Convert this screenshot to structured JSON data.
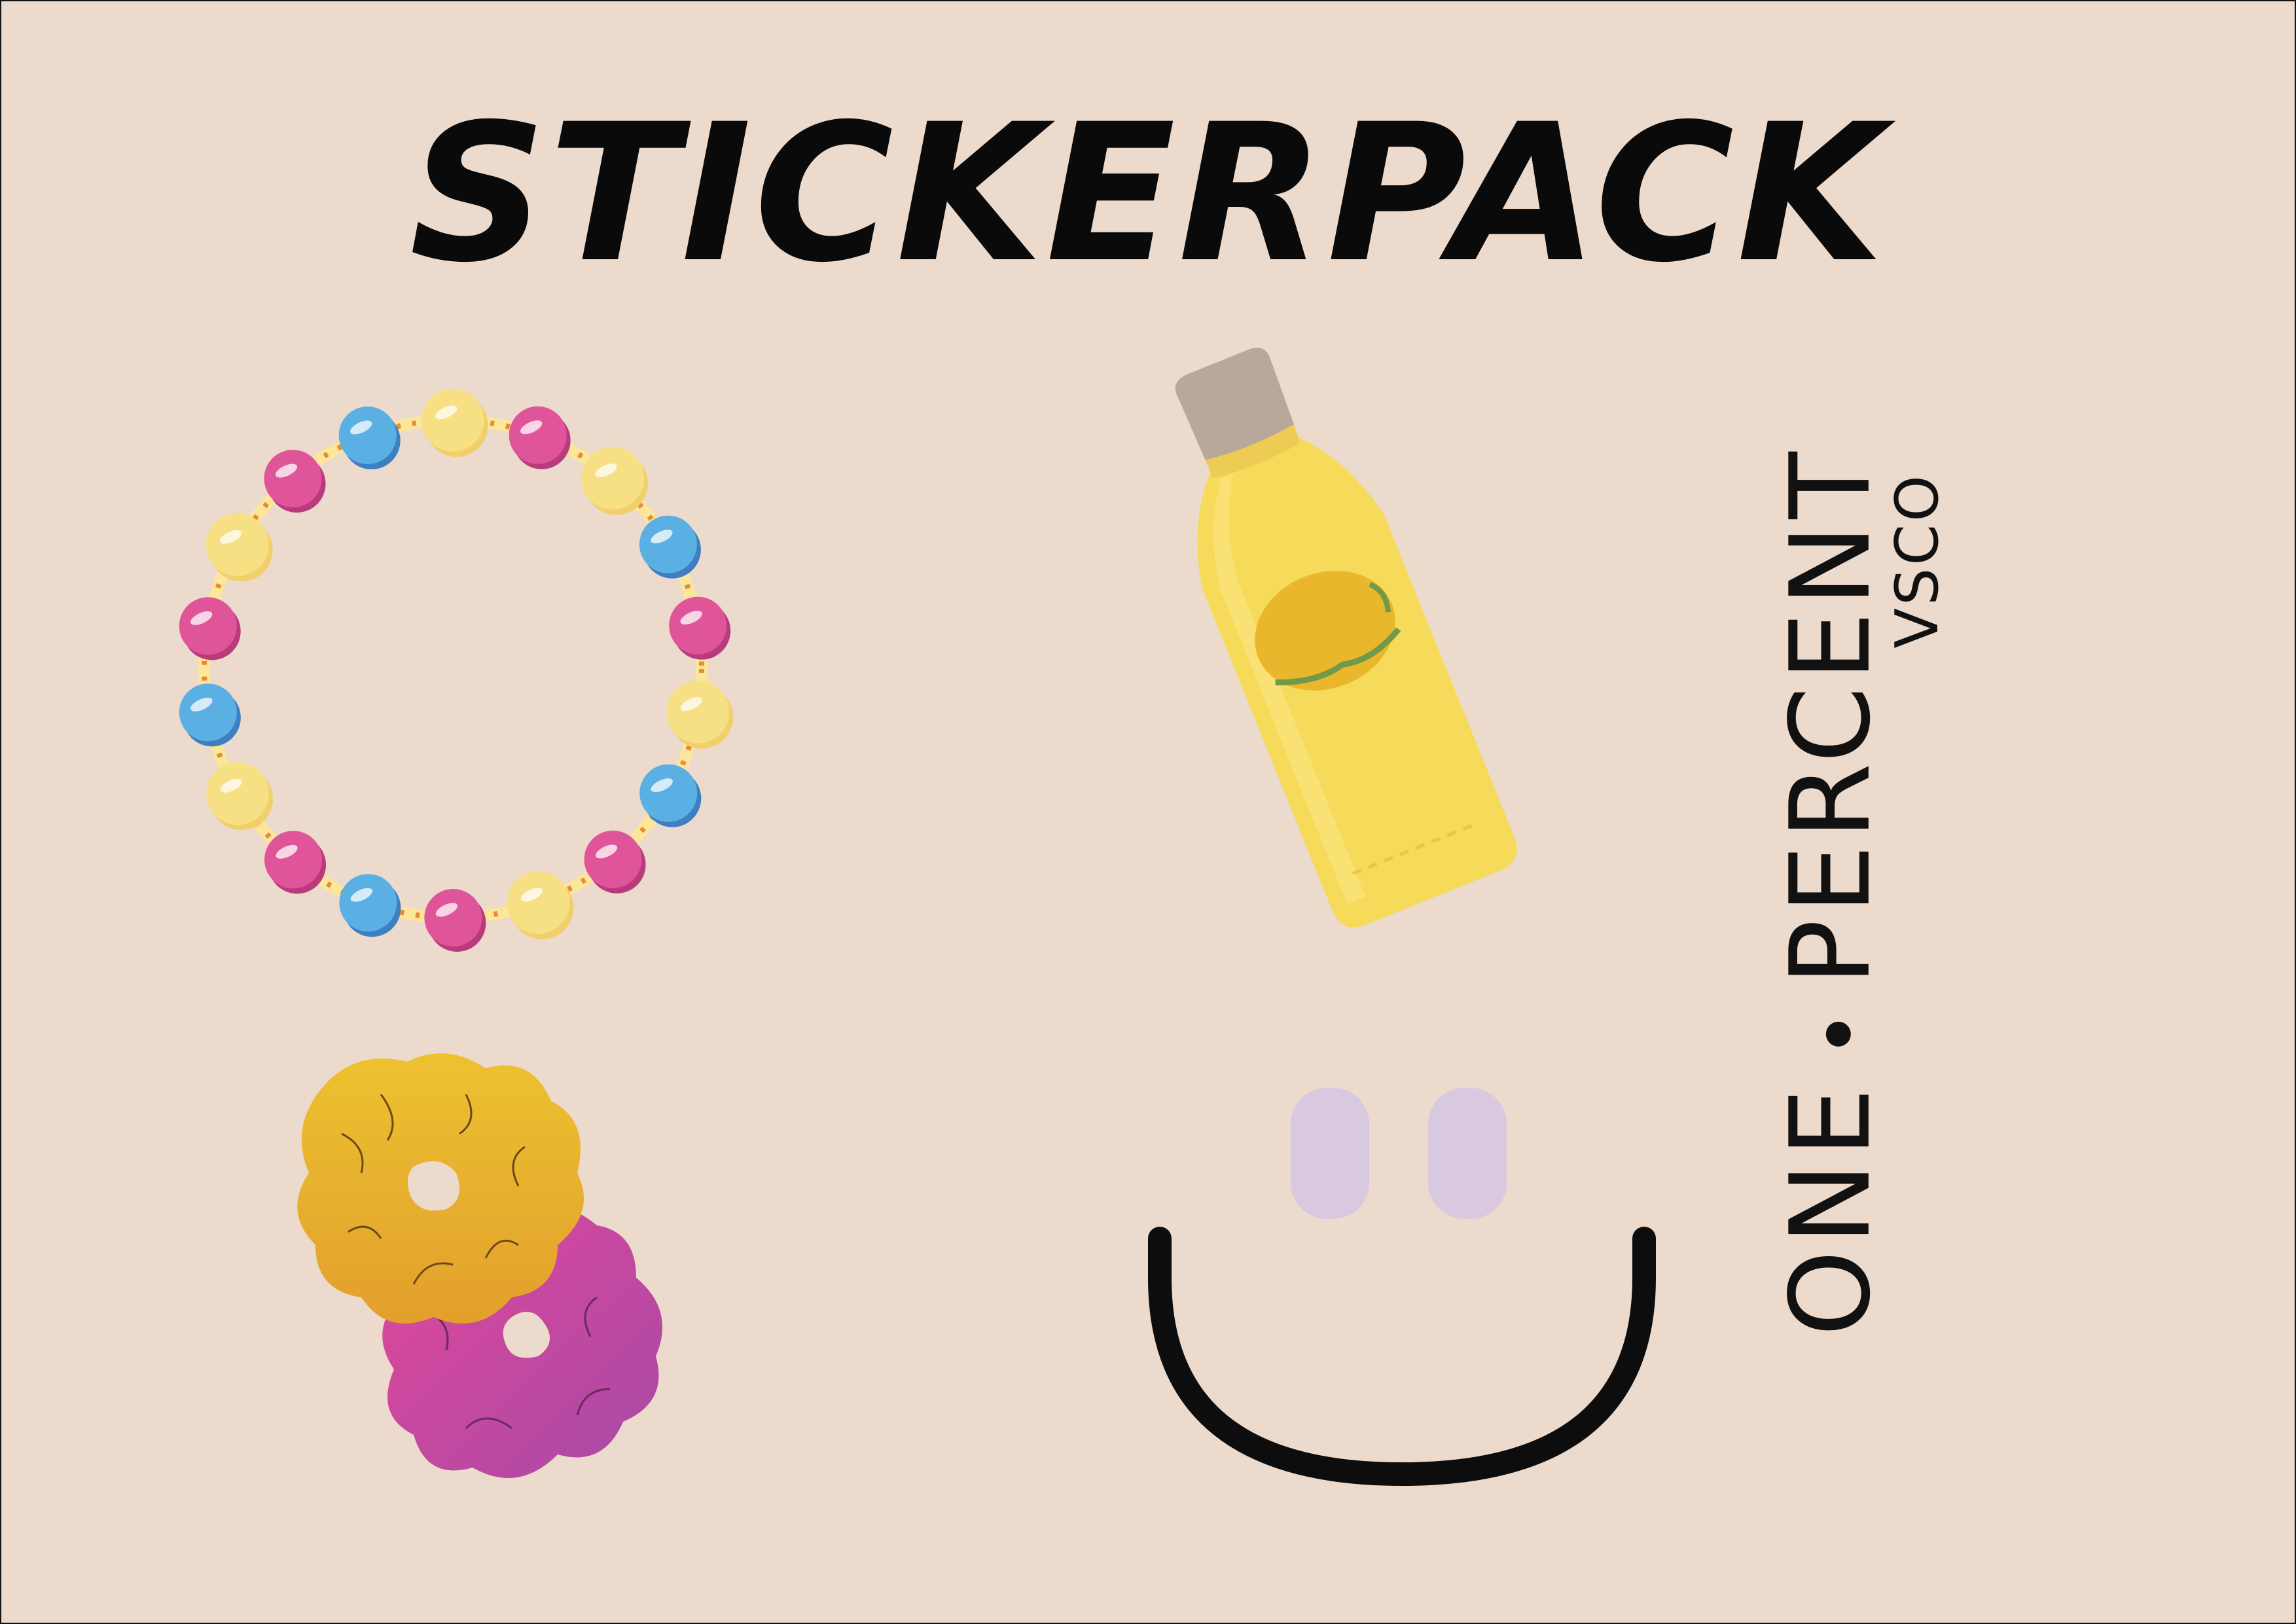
{
  "title": "STICKERPACK",
  "brand": {
    "word1": "ONE",
    "word2": "PERCENT",
    "sub": "VSCO"
  },
  "stickers": [
    {
      "name": "bead-bracelet",
      "icon": "bracelet-icon"
    },
    {
      "name": "yellow-water-bottle",
      "icon": "bottle-icon"
    },
    {
      "name": "scrunchies",
      "icon": "scrunchie-icon"
    },
    {
      "name": "smiley-face",
      "icon": "smiley-icon"
    }
  ],
  "colors": {
    "background": "#ecdacd",
    "text": "#0a0a0a",
    "bead_pink": "#e0559a",
    "bead_blue": "#5aafe3",
    "bead_yellow": "#f7df84",
    "bottle_yellow": "#f6da5a",
    "bottle_cap": "#b9a79b",
    "lemon": "#e9b62c",
    "scrunchie_yellow": "#e7b330",
    "scrunchie_magenta": "#c94a9e",
    "smiley_eyes": "#d8c8e0"
  }
}
